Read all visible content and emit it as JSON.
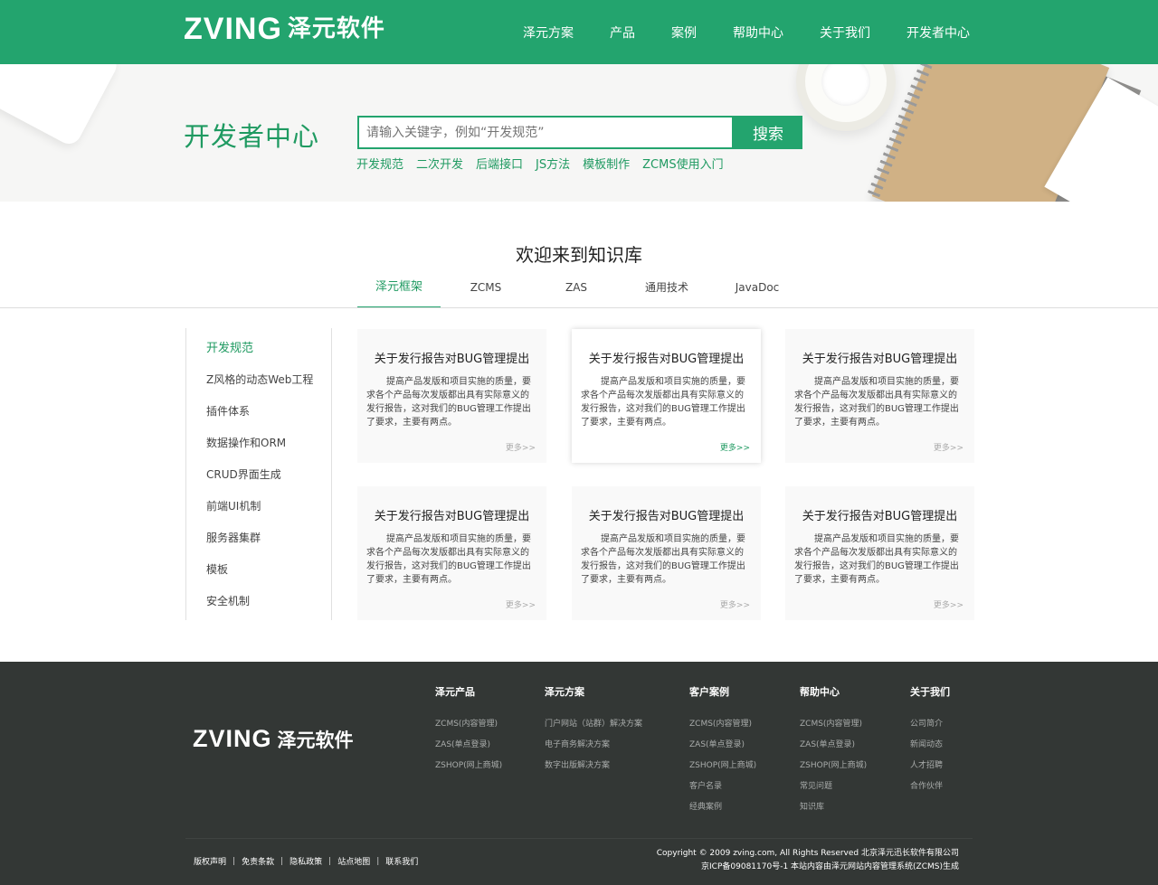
{
  "header": {
    "logo_latin": "ZVING",
    "logo_cn": "泽元软件",
    "nav": [
      "泽元方案",
      "产品",
      "案例",
      "帮助中心",
      "关于我们",
      "开发者中心"
    ]
  },
  "banner": {
    "title": "开发者中心",
    "search_placeholder": "请输入关键字，例如“开发规范”",
    "search_button": "搜索",
    "quick_links": [
      "开发规范",
      "二次开发",
      "后端接口",
      "JS方法",
      "模板制作",
      "ZCMS使用入门"
    ]
  },
  "knowledge": {
    "title": "欢迎来到知识库",
    "tabs": [
      "泽元框架",
      "ZCMS",
      "ZAS",
      "通用技术",
      "JavaDoc"
    ],
    "active_tab": "泽元框架"
  },
  "sidebar": {
    "items": [
      "开发规范",
      "Z风格的动态Web工程",
      "插件体系",
      "数据操作和ORM",
      "CRUD界面生成",
      "前端UI机制",
      "服务器集群",
      "模板",
      "安全机制"
    ]
  },
  "cards": [
    {
      "title": "关于发行报告对BUG管理提出",
      "body": "提高产品发版和项目实施的质量，要求各个产品每次发版都出具有实际意义的发行报告，这对我们的BUG管理工作提出了要求，主要有两点。",
      "more": "更多>>"
    },
    {
      "title": "关于发行报告对BUG管理提出",
      "body": "提高产品发版和项目实施的质量，要求各个产品每次发版都出具有实际意义的发行报告，这对我们的BUG管理工作提出了要求，主要有两点。",
      "more": "更多>>"
    },
    {
      "title": "关于发行报告对BUG管理提出",
      "body": "提高产品发版和项目实施的质量，要求各个产品每次发版都出具有实际意义的发行报告，这对我们的BUG管理工作提出了要求，主要有两点。",
      "more": "更多>>"
    },
    {
      "title": "关于发行报告对BUG管理提出",
      "body": "提高产品发版和项目实施的质量，要求各个产品每次发版都出具有实际意义的发行报告，这对我们的BUG管理工作提出了要求，主要有两点。",
      "more": "更多>>"
    },
    {
      "title": "关于发行报告对BUG管理提出",
      "body": "提高产品发版和项目实施的质量，要求各个产品每次发版都出具有实际意义的发行报告，这对我们的BUG管理工作提出了要求，主要有两点。",
      "more": "更多>>"
    },
    {
      "title": "关于发行报告对BUG管理提出",
      "body": "提高产品发版和项目实施的质量，要求各个产品每次发版都出具有实际意义的发行报告，这对我们的BUG管理工作提出了要求，主要有两点。",
      "more": "更多>>"
    }
  ],
  "footer": {
    "logo_latin": "ZVING",
    "logo_cn": "泽元软件",
    "columns": [
      {
        "title": "泽元产品",
        "links": [
          "ZCMS(内容管理)",
          "ZAS(单点登录)",
          "ZSHOP(网上商城)"
        ]
      },
      {
        "title": "泽元方案",
        "links": [
          "门户网站（站群）解决方案",
          "电子商务解决方案",
          "数字出版解决方案"
        ]
      },
      {
        "title": "客户案例",
        "links": [
          "ZCMS(内容管理)",
          "ZAS(单点登录)",
          "ZSHOP(网上商城)",
          "客户名录",
          "经典案例"
        ]
      },
      {
        "title": "帮助中心",
        "links": [
          "ZCMS(内容管理)",
          "ZAS(单点登录)",
          "ZSHOP(网上商城)",
          "常见问题",
          "知识库"
        ]
      },
      {
        "title": "关于我们",
        "links": [
          "公司简介",
          "新闻动态",
          "人才招聘",
          "合作伙伴"
        ]
      }
    ],
    "legal_links": [
      "版权声明",
      "免责条款",
      "隐私政策",
      "站点地图",
      "联系我们"
    ],
    "legal_separator": "|",
    "copyright_line1": "Copyright © 2009 zving.com, All Rights Reserved 北京泽元迅长软件有限公司",
    "copyright_line2": "京ICP备09081170号-1 本站内容由泽元网站内容管理系统(ZCMS)生成"
  },
  "colors": {
    "brand_green": "#23a46e",
    "footer_bg": "#333735"
  }
}
